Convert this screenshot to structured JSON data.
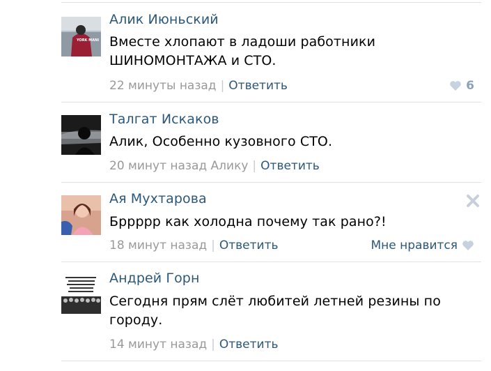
{
  "comments": [
    {
      "author": "Алик Июньский",
      "text": "Вместе хлопают в ладоши работники ШИНОМОНТАЖА и СТО.",
      "time": "22 минуты назад",
      "reply_to": "",
      "reply_label": "Ответить",
      "likes_count": "6",
      "like_label": "",
      "avatar_icon": "avatar-person-red-hoodie-icon",
      "avatar_caption": "YORK MANI"
    },
    {
      "author": "Талгат Искаков",
      "text": "Алик, Особенно кузовного СТО.",
      "time": "20 минут назад",
      "reply_to": "Алику",
      "reply_label": "Ответить",
      "likes_count": "",
      "like_label": "",
      "avatar_icon": "avatar-car-interior-icon",
      "avatar_caption": ""
    },
    {
      "author": "Ая Мухтарова",
      "text": "Брpppp как холодна почему так рано?!",
      "time": "18 минут назад",
      "reply_to": "",
      "reply_label": "Ответить",
      "likes_count": "",
      "like_label": "Мне нравится",
      "avatar_icon": "avatar-girl-photo-icon",
      "avatar_caption": ""
    },
    {
      "author": "Андрей Горн",
      "text": "Сегодня прям слёт любитей летней резины по городу.",
      "time": "14 минут назад",
      "reply_to": "",
      "reply_label": "Ответить",
      "likes_count": "",
      "like_label": "",
      "avatar_icon": "avatar-meme-text-icon",
      "avatar_caption": ""
    }
  ],
  "colors": {
    "link": "#2b587a",
    "meta": "#999999",
    "heart": "#a7b7c9",
    "separator": "#dfe3e8"
  }
}
